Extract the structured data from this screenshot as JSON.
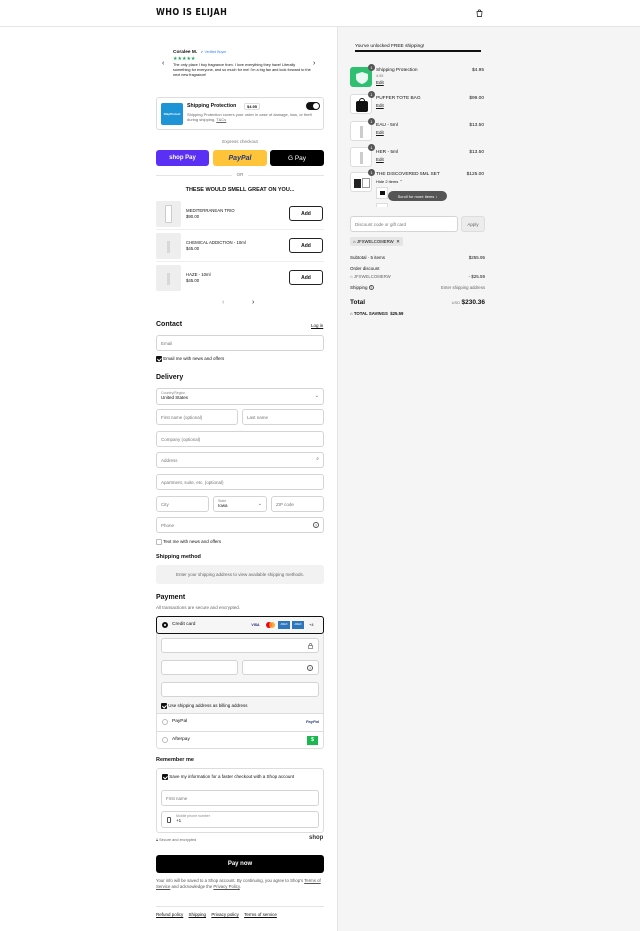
{
  "header": {
    "logo": "WHO IS ELIJAH",
    "cart_icon": "shopping-bag-icon"
  },
  "review": {
    "name": "Coralee M.",
    "verified": "Verified Buyer",
    "stars": "★★★★★",
    "text": "The only place I buy fragrance from. I love everything they have! Literally something for everyone, and so much for me! I'm a big fan and look forward to the next new fragrance!"
  },
  "shipping_protection": {
    "logo": "ShipProtect",
    "title": "Shipping Protection",
    "price": "$4.95",
    "desc": "Shipping Protection covers your order in case of damage, loss, or theft during shipping.",
    "tcs": "T&Cs"
  },
  "express": {
    "label": "Express checkout",
    "shop_pay": "shop Pay",
    "paypal": "PayPal",
    "gpay": "G Pay",
    "or": "OR"
  },
  "upsell": {
    "title": "THESE WOULD SMELL GREAT ON YOU...",
    "add_label": "Add",
    "items": [
      {
        "name": "MEDITERRANEAN TRIO",
        "price": "$90.00"
      },
      {
        "name": "CHEMICAL ADDICTION - 10ml",
        "price": "$45.00"
      },
      {
        "name": "HAZE - 10ml",
        "price": "$45.00"
      }
    ]
  },
  "contact": {
    "title": "Contact",
    "login": "Log in",
    "email_placeholder": "Email",
    "news_label": "Email me with news and offers"
  },
  "delivery": {
    "title": "Delivery",
    "country_label": "Country/Region",
    "country_value": "United States",
    "first_name": "First name (optional)",
    "last_name": "Last name",
    "company": "Company (optional)",
    "address": "Address",
    "apartment": "Apartment, suite, etc. (optional)",
    "city": "City",
    "state_label": "State",
    "state_value": "Iowa",
    "zip": "ZIP code",
    "phone": "Phone",
    "text_label": "Text me with news and offers"
  },
  "shipping_method": {
    "title": "Shipping method",
    "note": "Enter your shipping address to view available shipping methods."
  },
  "payment": {
    "title": "Payment",
    "subtitle": "All transactions are secure and encrypted.",
    "credit_card": "Credit card",
    "cards": [
      "VISA",
      "MC",
      "AMEX",
      "AMEX"
    ],
    "more_cards": "+4",
    "billing_label": "Use shipping address as billing address",
    "paypal": "PayPal",
    "paypal_logo": "PayPal",
    "afterpay": "Afterpay",
    "afterpay_logo": "$"
  },
  "remember": {
    "title": "Remember me",
    "save_label": "Save my information for a faster checkout with a Shop account",
    "first_name": "First name",
    "mobile_label": "Mobile phone number",
    "mobile_value": "+1",
    "secure": "Secure and encrypted",
    "shop": "shop"
  },
  "pay_now": "Pay now",
  "legal": {
    "text1": "Your info will be saved to a Shop account. By continuing, you agree to Shop's",
    "terms": "Terms of Service",
    "text2": "and acknowledge the",
    "privacy": "Privacy Policy",
    "end": "."
  },
  "footer": {
    "links": [
      "Refund policy",
      "Shipping",
      "Privacy policy",
      "Terms of service"
    ]
  },
  "summary": {
    "free_shipping": "You've unlocked FREE shipping!",
    "free_shipping_progress": 1.0,
    "items": [
      {
        "qty": "1",
        "name": "Shipping Protection",
        "sub": "4.95",
        "price": "$4.95",
        "edit": "Edit"
      },
      {
        "qty": "1",
        "name": "PUFFER TOTE BAG",
        "price": "$99.00",
        "edit": "Edit"
      },
      {
        "qty": "1",
        "name": "EAU - 5ml",
        "price": "$13.50",
        "edit": "Edit"
      },
      {
        "qty": "1",
        "name": "HER - 5ml",
        "price": "$13.50",
        "edit": "Edit"
      },
      {
        "qty": "1",
        "name": "THE DISCOVERED 5ML SET",
        "price": "$125.00",
        "hide": "Hide 2 items"
      }
    ],
    "scroll_more": "Scroll for more items",
    "discount_placeholder": "Discount code or gift card",
    "apply": "Apply",
    "code": "JFXWELCOMERW",
    "subtotal_label": "Subtotal · 5 items",
    "subtotal": "$255.95",
    "order_discount": "Order discount",
    "discount_code": "JFXWELCOMERW",
    "discount_value": "- $25.59",
    "shipping_label": "Shipping",
    "shipping_value": "Enter shipping address",
    "total_label": "Total",
    "currency": "USD",
    "total": "$230.36",
    "savings_label": "TOTAL SAVINGS",
    "savings": "$25.59"
  }
}
